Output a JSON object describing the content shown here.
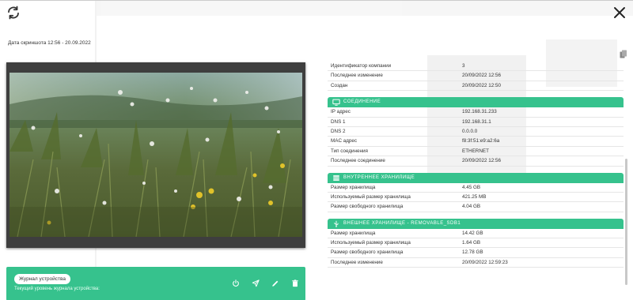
{
  "header": {
    "screenshot_date": "Дата скриншота 12:56 - 20.09.2022"
  },
  "top_rows": [
    {
      "key": "Идентификатор компании",
      "value": "3"
    },
    {
      "key": "Последнее изменение",
      "value": "20/09/2022 12:56"
    },
    {
      "key": "Создан",
      "value": "20/09/2022 12:50"
    }
  ],
  "connection": {
    "title": "Соединение",
    "rows": [
      {
        "key": "IP адрес",
        "value": "192.168.31.233"
      },
      {
        "key": "DNS 1",
        "value": "192.168.31.1"
      },
      {
        "key": "DNS 2",
        "value": "0.0.0.0"
      },
      {
        "key": "MAC адрес",
        "value": "f8:3f:51:e9:a2:6a"
      },
      {
        "key": "Тип соединения",
        "value": "ETHERNET"
      },
      {
        "key": "Последнее соединение",
        "value": "20/09/2022 12:56"
      }
    ]
  },
  "internal_storage": {
    "title": "Внутреннее хранилище",
    "rows": [
      {
        "key": "Размер хранилища",
        "value": "4.45 GB"
      },
      {
        "key": "Используемый размер хранилища",
        "value": "421.25 MB"
      },
      {
        "key": "Размер свободного хранилища",
        "value": "4.04 GB"
      }
    ]
  },
  "external_storage": {
    "title": "Внешнее хранилище - REMOVABLE_SDB1",
    "rows": [
      {
        "key": "Размер хранилища",
        "value": "14.42 GB"
      },
      {
        "key": "Используемый размер хранилища",
        "value": "1.64 GB"
      },
      {
        "key": "Размер свободного хранилища",
        "value": "12.78 GB"
      },
      {
        "key": "Последнее изменение",
        "value": "20/09/2022 12:59:23"
      }
    ]
  },
  "log": {
    "badge": "Журнал устройства",
    "level_text": "Текущий уровень журнала устройства:"
  },
  "colors": {
    "accent": "#36c28d",
    "frame": "#3e3e3e"
  },
  "icons": [
    "refresh-icon",
    "close-icon",
    "copy-icon",
    "monitor-icon",
    "list-icon",
    "usb-icon",
    "power-icon",
    "send-icon",
    "edit-icon",
    "trash-icon"
  ]
}
